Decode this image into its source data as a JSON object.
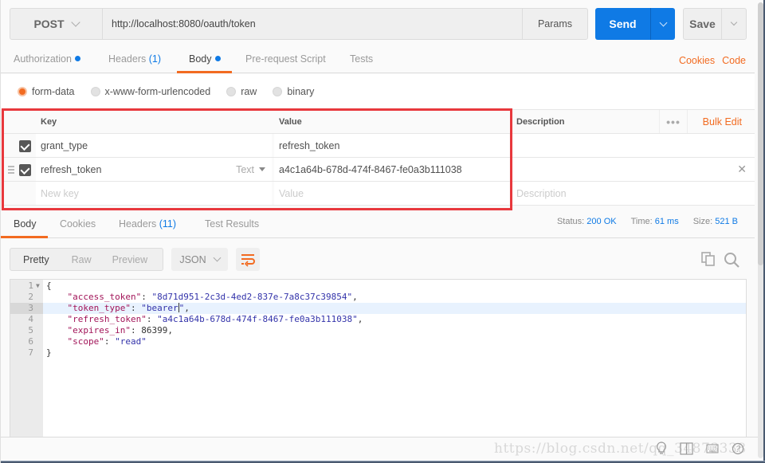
{
  "request": {
    "method": "POST",
    "url": "http://localhost:8080/oauth/token",
    "params_label": "Params",
    "send_label": "Send",
    "save_label": "Save"
  },
  "request_tabs": [
    {
      "label": "Authorization",
      "dot": true
    },
    {
      "label": "Headers",
      "count": "(1)"
    },
    {
      "label": "Body",
      "dot": true,
      "active": true
    },
    {
      "label": "Pre-request Script"
    },
    {
      "label": "Tests"
    }
  ],
  "links": {
    "cookies": "Cookies",
    "code": "Code"
  },
  "body_types": [
    {
      "label": "form-data",
      "selected": true
    },
    {
      "label": "x-www-form-urlencoded",
      "selected": false
    },
    {
      "label": "raw",
      "selected": false
    },
    {
      "label": "binary",
      "selected": false
    }
  ],
  "params_table": {
    "headers": {
      "key": "Key",
      "value": "Value",
      "description": "Description",
      "more": "•••",
      "bulk_edit": "Bulk Edit"
    },
    "rows": [
      {
        "checked": true,
        "key": "grant_type",
        "value": "refresh_token",
        "description": ""
      },
      {
        "checked": true,
        "key": "refresh_token",
        "type": "Text",
        "value": "a4c1a64b-678d-474f-8467-fe0a3b111038",
        "description": ""
      }
    ],
    "placeholders": {
      "key": "New key",
      "value": "Value",
      "description": "Description"
    }
  },
  "response_tabs": [
    {
      "label": "Body",
      "active": true
    },
    {
      "label": "Cookies"
    },
    {
      "label": "Headers",
      "count": "(11)"
    },
    {
      "label": "Test Results"
    }
  ],
  "response_status": {
    "status_label": "Status:",
    "status": "200 OK",
    "time_label": "Time:",
    "time": "61 ms",
    "size_label": "Size:",
    "size": "521 B"
  },
  "view_modes": [
    "Pretty",
    "Raw",
    "Preview"
  ],
  "active_view": "Pretty",
  "format": "JSON",
  "response_body": {
    "lines": [
      {
        "n": "1",
        "text": "{"
      },
      {
        "n": "2",
        "key": "\"access_token\"",
        "value": "\"8d71d951-2c3d-4ed2-837e-7a8c37c39854\"",
        "trail": ","
      },
      {
        "n": "3",
        "key": "\"token_type\"",
        "value": "\"bearer\"",
        "trail": ","
      },
      {
        "n": "4",
        "key": "\"refresh_token\"",
        "value": "\"a4c1a64b-678d-474f-8467-fe0a3b111038\"",
        "trail": ","
      },
      {
        "n": "5",
        "key": "\"expires_in\"",
        "number": "86399",
        "trail": ","
      },
      {
        "n": "6",
        "key": "\"scope\"",
        "value": "\"read\"",
        "trail": ""
      },
      {
        "n": "7",
        "text": "}"
      }
    ]
  },
  "watermark": "https://blog.csdn.net/qq_34873338",
  "colors": {
    "accent": "#f26b21",
    "primary": "#0f7ae5",
    "highlight_box": "#e8383d"
  }
}
